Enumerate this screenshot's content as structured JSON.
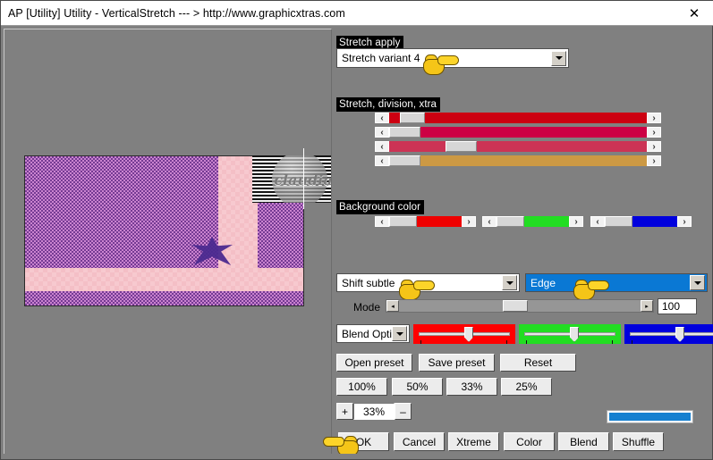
{
  "window": {
    "title": "AP [Utility]  Utility - VerticalStretch   --- > http://www.graphicxtras.com",
    "close_icon": "close-icon",
    "close_label": "✕"
  },
  "preview": {
    "name": "image-preview",
    "watermark_text": "claudia"
  },
  "stretch_apply": {
    "label": "Stretch apply",
    "variant_value": "Stretch variant 4",
    "dropdown_icon": "chevron-down-icon"
  },
  "stretch_division": {
    "label": "Stretch, division, xtra",
    "left_arrow": "‹",
    "right_arrow": "›",
    "sliders": [
      {
        "name": "stretch-slider-1",
        "color": "#CC0011",
        "thumb_pct": 7,
        "lead_color": "#CC0011",
        "lead_pct": 2
      },
      {
        "name": "stretch-slider-2",
        "color": "#CC0044",
        "thumb_pct": 0,
        "lead_color": "#CC0044",
        "lead_pct": 0
      },
      {
        "name": "stretch-slider-3",
        "color": "#CC3355",
        "thumb_pct": 23,
        "lead_color": "#CC3355",
        "lead_pct": 0
      },
      {
        "name": "stretch-slider-4",
        "color": "#CC9944",
        "thumb_pct": 0,
        "lead_color": "#CC9944",
        "lead_pct": 0
      }
    ]
  },
  "background_color": {
    "label": "Background color",
    "left_arrow": "‹",
    "right_arrow": "›",
    "channels": [
      {
        "name": "bg-red-slider",
        "color": "#EE0000",
        "thumb_pct": 12
      },
      {
        "name": "bg-green-slider",
        "color": "#22DD22",
        "thumb_pct": 12
      },
      {
        "name": "bg-blue-slider",
        "color": "#0000DD",
        "thumb_pct": 12
      }
    ]
  },
  "shift": {
    "value": "Shift subtle",
    "dropdown_icon": "chevron-down-icon"
  },
  "edge": {
    "value": "Edge",
    "dropdown_icon": "chevron-down-icon",
    "highlight_color": "#0A78D4"
  },
  "mode": {
    "label": "Mode",
    "value": "100",
    "thumb_pct": 43,
    "left_arrow": "◂",
    "right_arrow": "▸"
  },
  "blend": {
    "value": "Blend Opti",
    "dropdown_icon": "chevron-down-icon",
    "channels": [
      {
        "name": "blend-red-trackbar",
        "color": "#FF0000",
        "thumb_pct": 50
      },
      {
        "name": "blend-green-trackbar",
        "color": "#22DD22",
        "thumb_pct": 50
      },
      {
        "name": "blend-blue-trackbar",
        "color": "#0000DD",
        "thumb_pct": 50
      }
    ]
  },
  "preset_buttons": [
    {
      "name": "open-preset-button",
      "label": "Open preset"
    },
    {
      "name": "save-preset-button",
      "label": "Save preset"
    },
    {
      "name": "reset-button",
      "label": "Reset"
    }
  ],
  "zoom_buttons": [
    {
      "name": "zoom-100-button",
      "label": "100%"
    },
    {
      "name": "zoom-50-button",
      "label": "50%"
    },
    {
      "name": "zoom-33-button",
      "label": "33%"
    },
    {
      "name": "zoom-25-button",
      "label": "25%"
    }
  ],
  "zoom_stepper": {
    "plus_label": "+",
    "value": "33%",
    "minus_label": "–"
  },
  "progress": {
    "name": "progress-bar",
    "color": "#1580D0"
  },
  "action_buttons": [
    {
      "name": "ok-button",
      "label": "OK"
    },
    {
      "name": "cancel-button",
      "label": "Cancel"
    },
    {
      "name": "xtreme-button",
      "label": "Xtreme"
    },
    {
      "name": "color-button",
      "label": "Color"
    },
    {
      "name": "blend-button",
      "label": "Blend"
    },
    {
      "name": "shuffle-button",
      "label": "Shuffle"
    }
  ]
}
